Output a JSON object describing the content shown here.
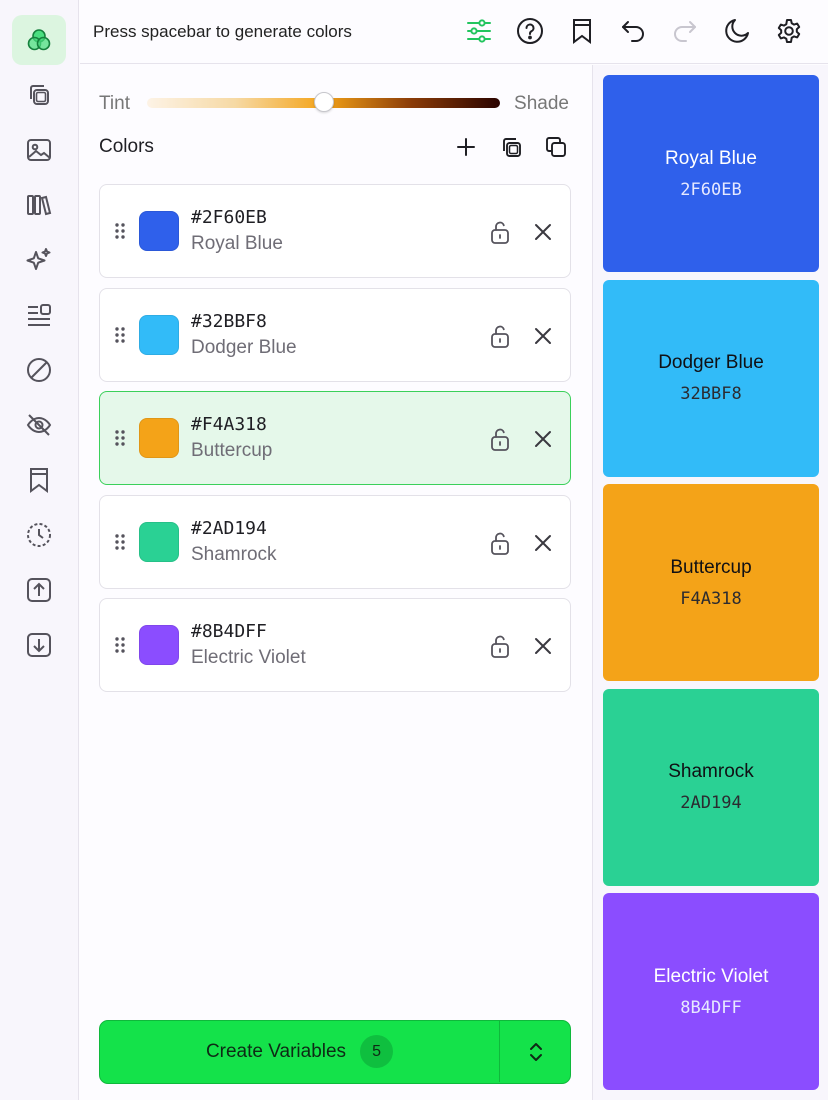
{
  "topbar": {
    "hint": "Press spacebar to generate colors",
    "icons": [
      "adjustments-icon",
      "help-icon",
      "bookmark-icon",
      "undo-icon",
      "redo-icon",
      "dark-mode-icon",
      "settings-icon"
    ],
    "accent": "#22c55e"
  },
  "sidebar": {
    "items": [
      "palette-generator",
      "duplicate",
      "image-extract",
      "library",
      "ai-magic",
      "list-view",
      "disable",
      "hide",
      "bookmarks",
      "history",
      "export",
      "import"
    ],
    "active": "palette-generator"
  },
  "adjust": {
    "tint_label": "Tint",
    "shade_label": "Shade",
    "slider_value": 0.5
  },
  "colors_section": {
    "title": "Colors"
  },
  "colors": [
    {
      "hex": "#2F60EB",
      "name": "Royal Blue",
      "short": "2F60EB",
      "value": "#2F60EB",
      "selected": false,
      "text": "light"
    },
    {
      "hex": "#32BBF8",
      "name": "Dodger Blue",
      "short": "32BBF8",
      "value": "#32BBF8",
      "selected": false,
      "text": "dark"
    },
    {
      "hex": "#F4A318",
      "name": "Buttercup",
      "short": "F4A318",
      "value": "#F4A318",
      "selected": true,
      "text": "dark"
    },
    {
      "hex": "#2AD194",
      "name": "Shamrock",
      "short": "2AD194",
      "value": "#2AD194",
      "selected": false,
      "text": "dark"
    },
    {
      "hex": "#8B4DFF",
      "name": "Electric Violet",
      "short": "8B4DFF",
      "value": "#8B4DFF",
      "selected": false,
      "text": "light"
    }
  ],
  "create_button": {
    "label": "Create Variables",
    "count": "5"
  }
}
